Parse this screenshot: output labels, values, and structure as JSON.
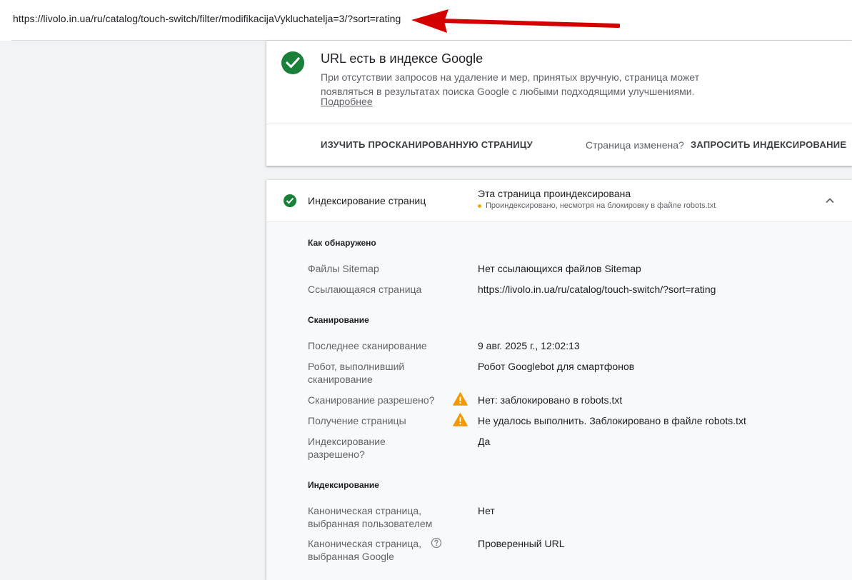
{
  "header": {
    "inspected_url": "https://livolo.in.ua/ru/catalog/touch-switch/filter/modifikacijaVykluchatelja=3/?sort=rating"
  },
  "status_card": {
    "title": "URL есть в индексе Google",
    "description": "При отсутствии запросов на удаление и мер, принятых вручную, страница может появляться в результатах поиска Google с любыми подходящими улучшениями.",
    "learn_more": "Подробнее",
    "inspect_button": "ИЗУЧИТЬ ПРОСКАНИРОВАННУЮ СТРАНИЦУ",
    "page_changed": "Страница изменена?",
    "request_button": "ЗАПРОСИТЬ ИНДЕКСИРОВАНИЕ",
    "status_color": "#188038"
  },
  "indexing_panel": {
    "title": "Индексирование страниц",
    "summary": "Эта страница проиндексирована",
    "sub_status": "Проиндексировано, несмотря на блокировку в файле robots.txt",
    "warning_color": "#f9ab00",
    "discovery": {
      "title": "Как обнаружено",
      "rows": [
        {
          "label": "Файлы Sitemap",
          "value": "Нет ссылающихся файлов Sitemap"
        },
        {
          "label": "Ссылающаяся страница",
          "value": "https://livolo.in.ua/ru/catalog/touch-switch/?sort=rating"
        }
      ]
    },
    "crawl": {
      "title": "Сканирование",
      "rows": [
        {
          "label": "Последнее сканирование",
          "value": "9 авг. 2025 г., 12:02:13"
        },
        {
          "label": "Робот, выполнивший сканирование",
          "value": "Робот Googlebot для смартфонов"
        },
        {
          "label": "Сканирование разрешено?",
          "value": "Нет: заблокировано в robots.txt",
          "icon": "warning-icon"
        },
        {
          "label": "Получение страницы",
          "value": "Не удалось выполнить. Заблокировано в файле robots.txt",
          "icon": "warning-icon"
        },
        {
          "label": "Индексирование разрешено?",
          "value": "Да"
        }
      ]
    },
    "indexing": {
      "title": "Индексирование",
      "rows": [
        {
          "label": "Каноническая страница, выбранная пользователем",
          "value": "Нет"
        },
        {
          "label": "Каноническая страница, выбранная Google",
          "value": "Проверенный URL",
          "icon": "help-icon"
        }
      ]
    }
  }
}
